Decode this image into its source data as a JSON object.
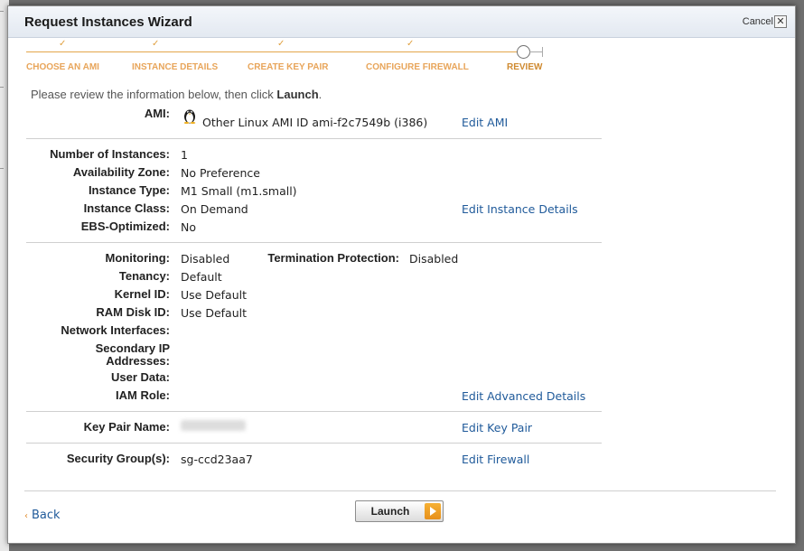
{
  "dialog": {
    "title": "Request Instances Wizard",
    "cancel_label": "Cancel",
    "close_glyph": "✕"
  },
  "steps": [
    {
      "label": "CHOOSE AN AMI",
      "done": true
    },
    {
      "label": "INSTANCE DETAILS",
      "done": true
    },
    {
      "label": "CREATE KEY PAIR",
      "done": true
    },
    {
      "label": "CONFIGURE FIREWALL",
      "done": true
    },
    {
      "label": "REVIEW",
      "current": true
    }
  ],
  "intro": {
    "prefix": "Please review the information below, then click ",
    "bold": "Launch",
    "suffix": "."
  },
  "ami": {
    "label": "AMI:",
    "value": "Other Linux AMI ID ami-f2c7549b (i386)",
    "edit": "Edit AMI",
    "icon": "linux-tux-icon"
  },
  "instance": {
    "fields": [
      {
        "label": "Number of Instances:",
        "value": "1"
      },
      {
        "label": "Availability Zone:",
        "value": "No Preference"
      },
      {
        "label": "Instance Type:",
        "value": "M1 Small (m1.small)"
      },
      {
        "label": "Instance Class:",
        "value": "On Demand"
      },
      {
        "label": "EBS-Optimized:",
        "value": "No"
      }
    ],
    "edit": "Edit Instance Details"
  },
  "advanced": {
    "monitoring_label": "Monitoring:",
    "monitoring_value": "Disabled",
    "termination_label": "Termination Protection:",
    "termination_value": "Disabled",
    "fields": [
      {
        "label": "Tenancy:",
        "value": "Default"
      },
      {
        "label": "Kernel ID:",
        "value": "Use Default"
      },
      {
        "label": "RAM Disk ID:",
        "value": "Use Default"
      },
      {
        "label": "Network Interfaces:",
        "value": ""
      },
      {
        "label": "Secondary IP",
        "value": ""
      },
      {
        "label": "Addresses:",
        "value": ""
      },
      {
        "label": "User Data:",
        "value": ""
      },
      {
        "label": "IAM Role:",
        "value": ""
      }
    ],
    "edit": "Edit Advanced Details"
  },
  "keypair": {
    "label": "Key Pair Name:",
    "edit": "Edit Key Pair"
  },
  "security": {
    "label": "Security Group(s):",
    "value": "sg-ccd23aa7",
    "edit": "Edit Firewall"
  },
  "footer": {
    "back_arrow": "‹",
    "back_label": "Back",
    "launch_label": "Launch"
  },
  "colors": {
    "step_accent": "#e8a55a",
    "link": "#1f5a9a",
    "launch_arrow": "#f0a22a"
  }
}
